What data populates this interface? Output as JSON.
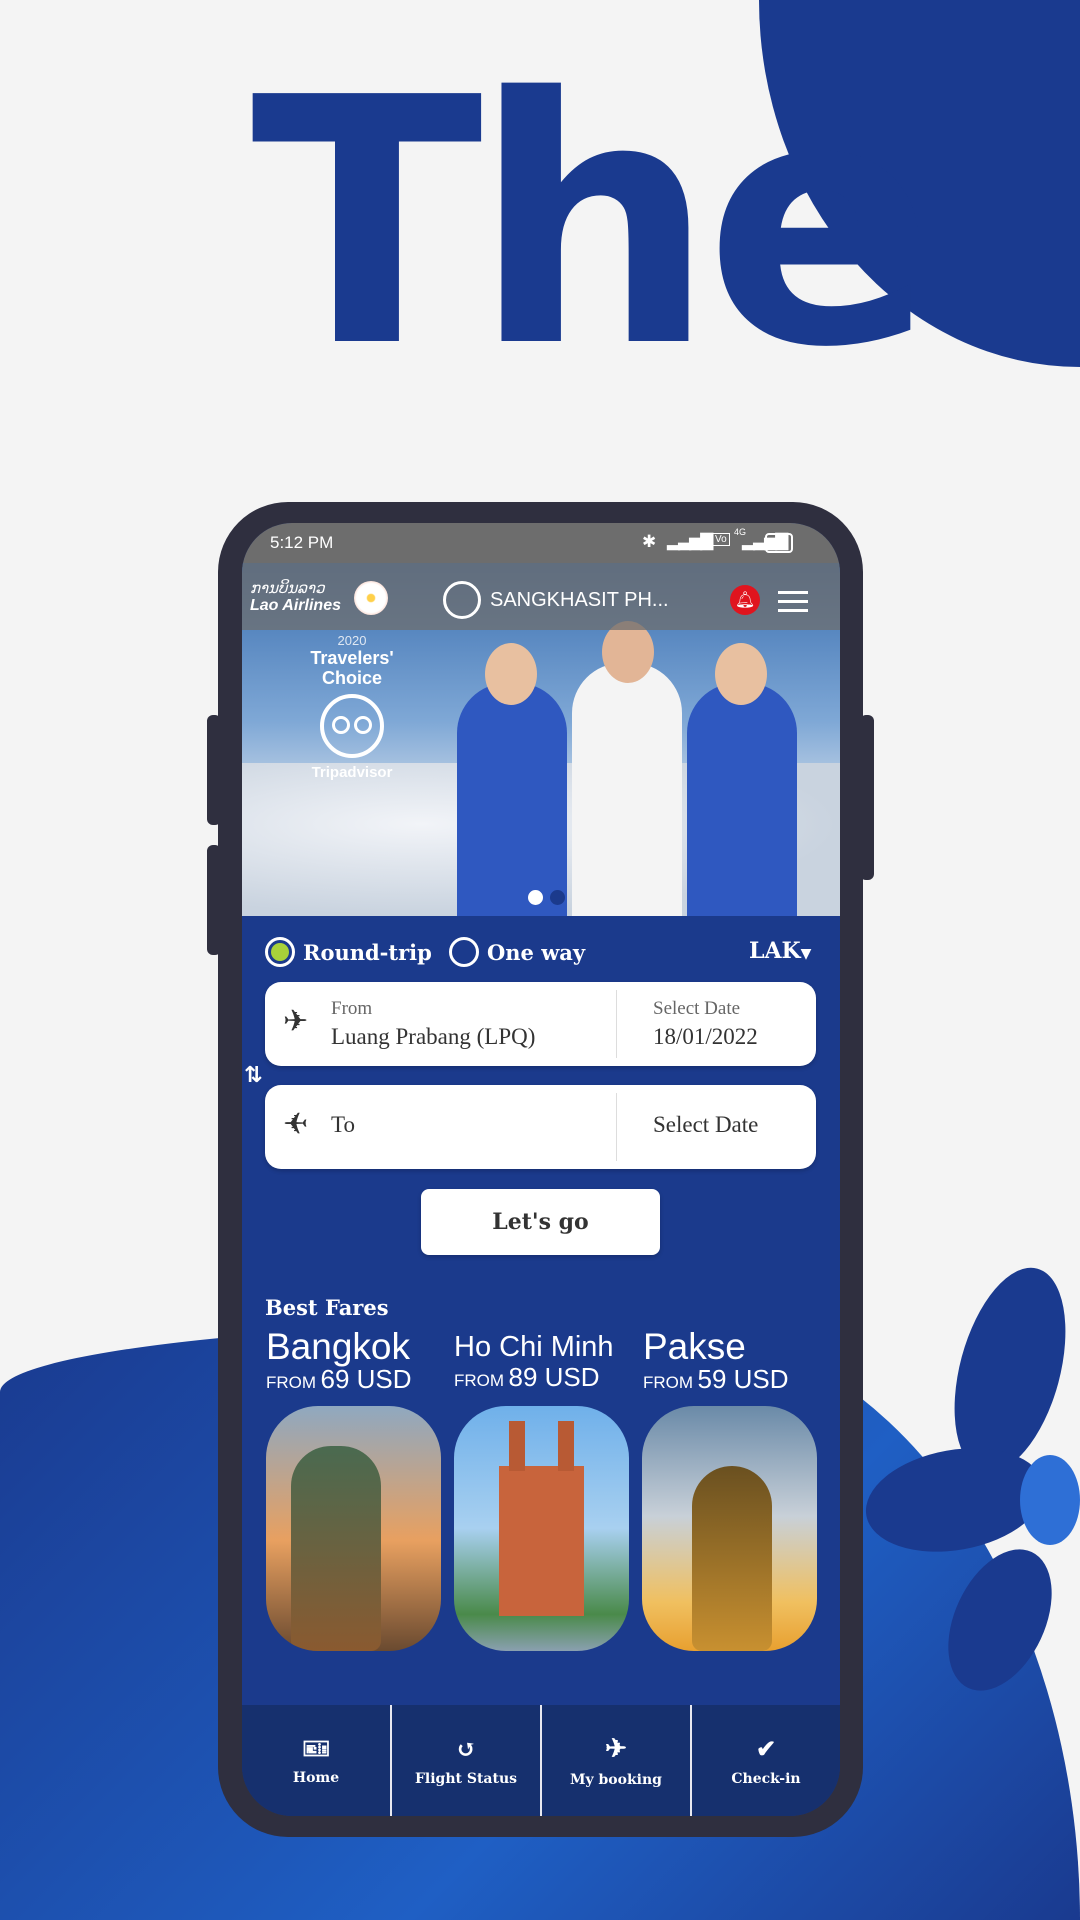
{
  "headline": "The",
  "colors": {
    "brand_blue": "#1a3a8f",
    "form_blue": "#1b3a8c",
    "radio_active": "#a8d13a",
    "alert_red": "#e0141e"
  },
  "status_bar": {
    "time": "5:12 PM",
    "battery": "96",
    "network": "4G"
  },
  "header": {
    "logo_lao": "ການບິນລາວ",
    "logo_text": "Lao Airlines",
    "user_name": "SANGKHASIT PH...",
    "icons": [
      "user-avatar-icon",
      "bell-alert-icon",
      "hamburger-menu-icon"
    ]
  },
  "hero": {
    "badge_year": "2020",
    "badge_title": "Travelers' Choice",
    "badge_brand": "Tripadvisor",
    "carousel": {
      "count": 2,
      "active": 0
    }
  },
  "booking": {
    "trip_types": [
      {
        "label": "Round-trip",
        "selected": true
      },
      {
        "label": "One way",
        "selected": false
      }
    ],
    "currency": "LAK",
    "from": {
      "label": "From",
      "value": "Luang Prabang (LPQ)",
      "date_label": "Select Date",
      "date_value": "18/01/2022"
    },
    "to": {
      "label": "To",
      "date_label": "Select Date"
    },
    "submit": "Let's go"
  },
  "best_fares": {
    "title": "Best Fares",
    "items": [
      {
        "city": "Bangkok",
        "from": "FROM",
        "price": "69 USD"
      },
      {
        "city": "Ho Chi Minh",
        "from": "FROM",
        "price": "89 USD"
      },
      {
        "city": "Pakse",
        "from": "FROM",
        "price": "59 USD"
      }
    ]
  },
  "nav": [
    {
      "label": "Home",
      "icon": "ticket-plane-icon"
    },
    {
      "label": "Flight Status",
      "icon": "history-clock-icon"
    },
    {
      "label": "My booking",
      "icon": "airplane-icon"
    },
    {
      "label": "Check-in",
      "icon": "location-check-icon"
    }
  ]
}
